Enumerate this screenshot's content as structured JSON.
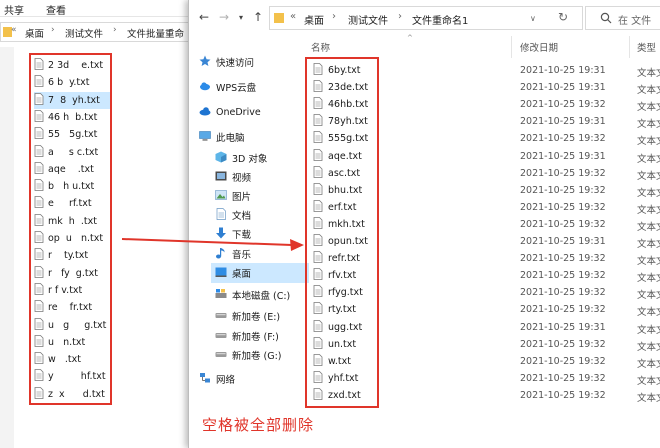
{
  "left_window": {
    "menu": [
      "共享",
      "查看"
    ],
    "breadcrumb": [
      "«",
      "桌面",
      "测试文件",
      "文件批量重命"
    ],
    "files": [
      "2 3d    e.txt",
      "6 b  y.txt",
      "7  8  yh.txt",
      "46 h  b.txt",
      "55   5g.txt",
      "a     s c.txt",
      "aqe    .txt",
      "b   h u.txt",
      "e     rf.txt",
      "mk  h  .txt",
      "op  u   n.txt",
      "r    ty.txt",
      "r   fy  g.txt",
      "r f v.txt",
      "re    fr.txt",
      "u   g     g.txt",
      "u   n.txt",
      "w   .txt",
      "y         hf.txt",
      "z  x      d.txt"
    ],
    "selected_index": 2
  },
  "right_window": {
    "breadcrumb": [
      "«",
      "桌面",
      "测试文件",
      "文件重命名1"
    ],
    "search_placeholder": "在 文件",
    "columns": {
      "name": "名称",
      "date": "修改日期",
      "type": "类型"
    },
    "nav": [
      {
        "label": "快速访问",
        "icon": "star-icon"
      },
      {
        "label": "WPS云盘",
        "icon": "cloud-icon"
      },
      {
        "label": "OneDrive",
        "icon": "onedrive-icon"
      },
      {
        "label": "此电脑",
        "icon": "computer-icon"
      },
      {
        "label": "3D 对象",
        "icon": "cube-icon"
      },
      {
        "label": "视频",
        "icon": "video-icon"
      },
      {
        "label": "图片",
        "icon": "picture-icon"
      },
      {
        "label": "文档",
        "icon": "document-icon"
      },
      {
        "label": "下载",
        "icon": "download-icon"
      },
      {
        "label": "音乐",
        "icon": "music-icon"
      },
      {
        "label": "桌面",
        "icon": "desktop-icon"
      },
      {
        "label": "本地磁盘 (C:)",
        "icon": "drive-c-icon"
      },
      {
        "label": "新加卷 (E:)",
        "icon": "drive-icon"
      },
      {
        "label": "新加卷 (F:)",
        "icon": "drive-icon"
      },
      {
        "label": "新加卷 (G:)",
        "icon": "drive-icon"
      },
      {
        "label": "网络",
        "icon": "network-icon"
      }
    ],
    "nav_selected": "桌面",
    "files": [
      {
        "name": "6by.txt",
        "date": "2021-10-25 19:31",
        "type": "文本文"
      },
      {
        "name": "23de.txt",
        "date": "2021-10-25 19:31",
        "type": "文本文"
      },
      {
        "name": "46hb.txt",
        "date": "2021-10-25 19:32",
        "type": "文本文"
      },
      {
        "name": "78yh.txt",
        "date": "2021-10-25 19:31",
        "type": "文本文"
      },
      {
        "name": "555g.txt",
        "date": "2021-10-25 19:32",
        "type": "文本文"
      },
      {
        "name": "aqe.txt",
        "date": "2021-10-25 19:31",
        "type": "文本文"
      },
      {
        "name": "asc.txt",
        "date": "2021-10-25 19:32",
        "type": "文本文"
      },
      {
        "name": "bhu.txt",
        "date": "2021-10-25 19:32",
        "type": "文本文"
      },
      {
        "name": "erf.txt",
        "date": "2021-10-25 19:32",
        "type": "文本文"
      },
      {
        "name": "mkh.txt",
        "date": "2021-10-25 19:32",
        "type": "文本文"
      },
      {
        "name": "opun.txt",
        "date": "2021-10-25 19:31",
        "type": "文本文"
      },
      {
        "name": "refr.txt",
        "date": "2021-10-25 19:32",
        "type": "文本文"
      },
      {
        "name": "rfv.txt",
        "date": "2021-10-25 19:32",
        "type": "文本文"
      },
      {
        "name": "rfyg.txt",
        "date": "2021-10-25 19:32",
        "type": "文本文"
      },
      {
        "name": "rty.txt",
        "date": "2021-10-25 19:32",
        "type": "文本文"
      },
      {
        "name": "ugg.txt",
        "date": "2021-10-25 19:31",
        "type": "文本文"
      },
      {
        "name": "un.txt",
        "date": "2021-10-25 19:32",
        "type": "文本文"
      },
      {
        "name": "w.txt",
        "date": "2021-10-25 19:32",
        "type": "文本文"
      },
      {
        "name": "yhf.txt",
        "date": "2021-10-25 19:32",
        "type": "文本文"
      },
      {
        "name": "zxd.txt",
        "date": "2021-10-25 19:32",
        "type": "文本文"
      }
    ]
  },
  "annotation": {
    "caption": "空格被全部删除",
    "highlight_color": "#e0352a"
  }
}
